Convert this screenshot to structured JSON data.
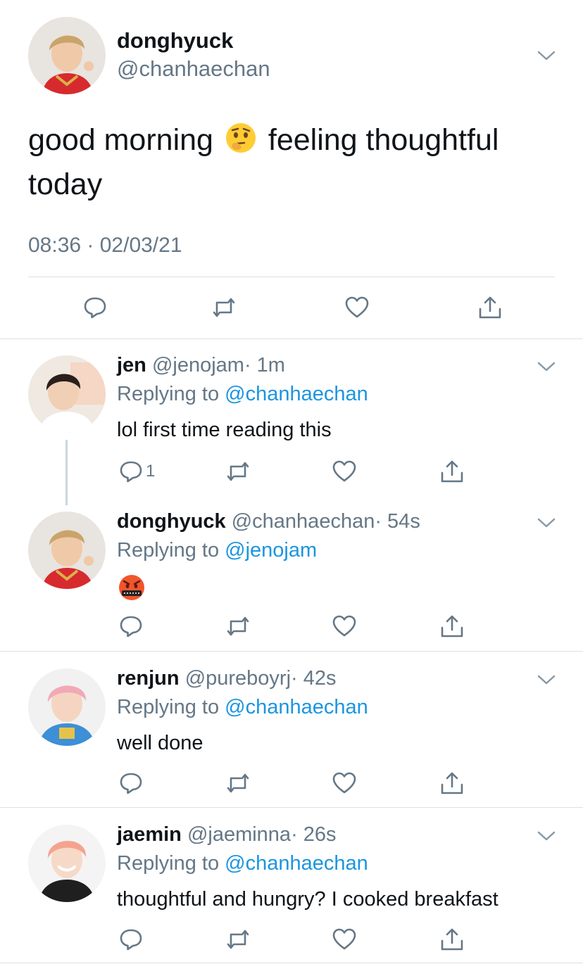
{
  "main_tweet": {
    "display_name": "donghyuck",
    "handle": "@chanhaechan",
    "text_part1": "good morning",
    "text_part2": "feeling thoughtful",
    "text_part3": "today",
    "emoji": "thinking-face",
    "timestamp": "08:36 · 02/03/21"
  },
  "replies": [
    {
      "display_name": "jen",
      "handle": "@jenojam",
      "time": "· 1m",
      "replying_label": "Replying to",
      "replying_to": "@chanhaechan",
      "text": "lol first time reading this",
      "reply_count": "1"
    },
    {
      "display_name": "donghyuck",
      "handle": "@chanhaechan",
      "time": "· 54s",
      "replying_label": "Replying to",
      "replying_to": "@jenojam",
      "emoji": "face-with-symbols-on-mouth"
    },
    {
      "display_name": "renjun",
      "handle": "@pureboyrj",
      "time": "· 42s",
      "replying_label": "Replying to",
      "replying_to": "@chanhaechan",
      "text": "well done"
    },
    {
      "display_name": "jaemin",
      "handle": "@jaeminna",
      "time": "· 26s",
      "replying_label": "Replying to",
      "replying_to": "@chanhaechan",
      "text": "thoughtful and hungry? I cooked breakfast"
    }
  ],
  "colors": {
    "text": "#0f1419",
    "secondary": "#657786",
    "link": "#1b95e0",
    "divider": "#dbe1e6"
  },
  "icons": [
    "chevron-down-icon",
    "reply-icon",
    "retweet-icon",
    "like-icon",
    "share-icon"
  ]
}
